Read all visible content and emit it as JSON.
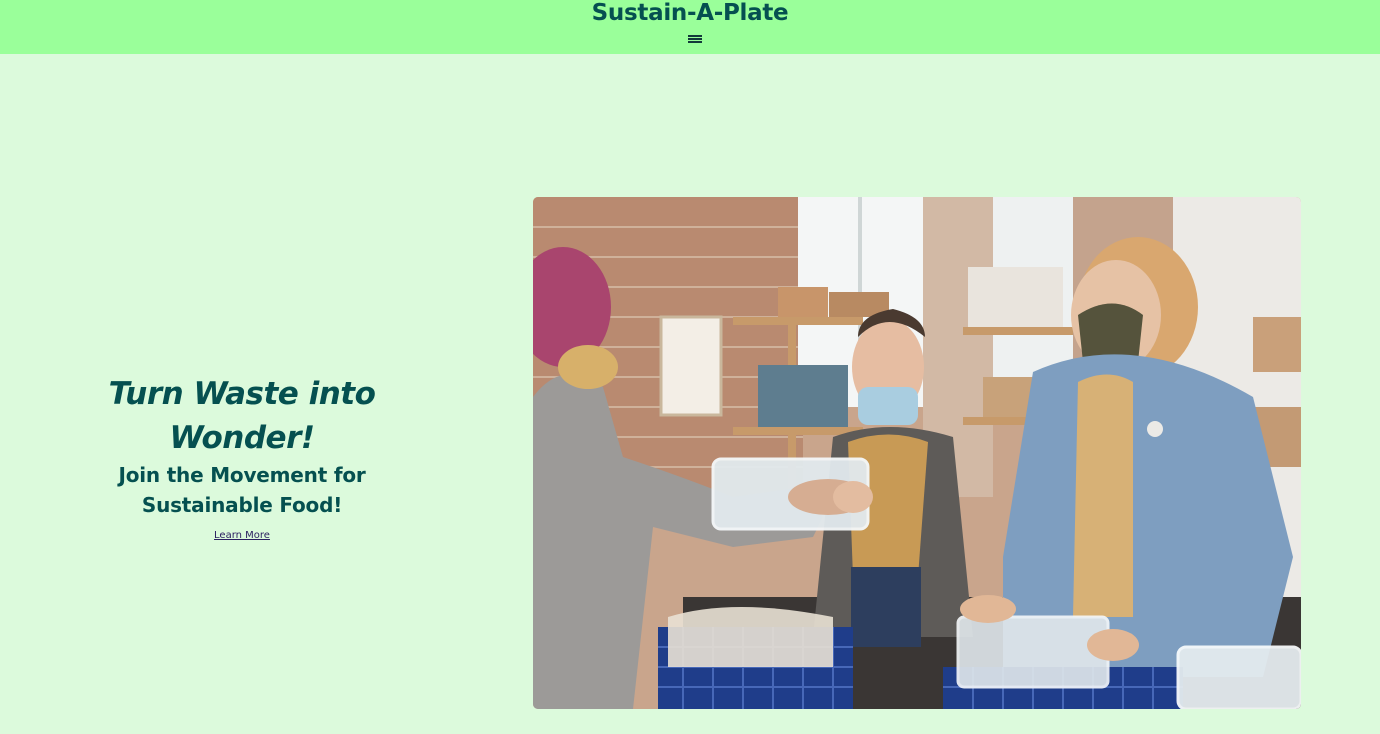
{
  "header": {
    "title": "Sustain-A-Plate",
    "menu_icon": "hamburger-icon",
    "background": "#9aff9a",
    "title_color": "#055050"
  },
  "hero": {
    "headline": "Turn Waste into Wonder!",
    "subheadline": "Join the Movement for Sustainable Food!",
    "cta_label": "Learn More",
    "image_alt": "Volunteers wearing masks handing over food containers at a food bank",
    "background": "#dcfadc"
  }
}
